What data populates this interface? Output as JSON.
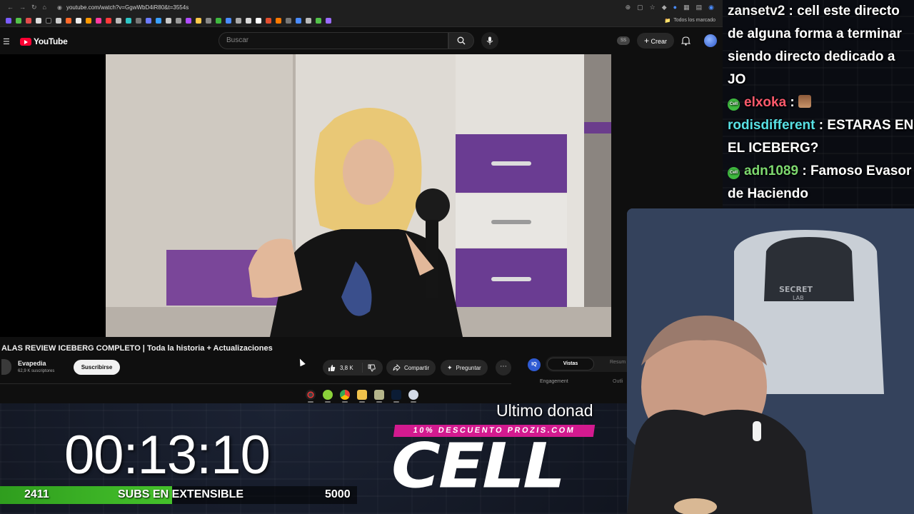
{
  "browser": {
    "url": "youtube.com/watch?v=GgwWbD4iR80&t=3554s",
    "bookmarks_folder_label": "Todos los marcado"
  },
  "youtube": {
    "logo_text": "YouTube",
    "search": {
      "placeholder": "Buscar"
    },
    "ss_badge": "SS",
    "create_label": "Crear"
  },
  "video": {
    "title": "ALAS REVIEW ICEBERG COMPLETO | Toda la historia + Actualizaciones",
    "channel_name": "Evapedia",
    "channel_subs": "62,9 K suscriptores",
    "subscribe_label": "Suscribirse",
    "likes": "3,8 K",
    "share_label": "Compartir",
    "ask_label": "Preguntar"
  },
  "extension": {
    "icon_text": "IQ",
    "tab_active": "Vistas",
    "tab_second": "Resum",
    "sub_label": "Engagement",
    "sub_label_2": "Outli"
  },
  "chat": [
    {
      "user": "zansetv2",
      "user_color": "#f2f2f2",
      "message": "cell este directo de alguna forma a terminar siendo directo dedicado a JO",
      "badge": false,
      "emote": false
    },
    {
      "user": "elxoka",
      "user_color": "#ff5a6c",
      "message": "",
      "badge": true,
      "emote": true
    },
    {
      "user": "rodisdifferent",
      "user_color": "#58e0e4",
      "message": "ESTARAS EN EL ICEBERG?",
      "badge": false,
      "emote": false
    },
    {
      "user": "adn1089",
      "user_color": "#7dd86f",
      "message": "Famoso Evasor de Haciendo",
      "badge": true,
      "emote": false
    }
  ],
  "overlay": {
    "timer": "00:13:10",
    "subs_current": "2411",
    "subs_label": "SUBS EN EXTENSIBLE",
    "subs_goal": "5000",
    "subs_progress": 0.482,
    "donation_label": "Ultimo donad",
    "promo": "10% DESCUENTO PROZIS.COM",
    "brand": "CELL"
  },
  "colors": {
    "youtube_red": "#ff0033",
    "subs_green": "#45c22b",
    "promo_pink": "#d31a8f"
  }
}
